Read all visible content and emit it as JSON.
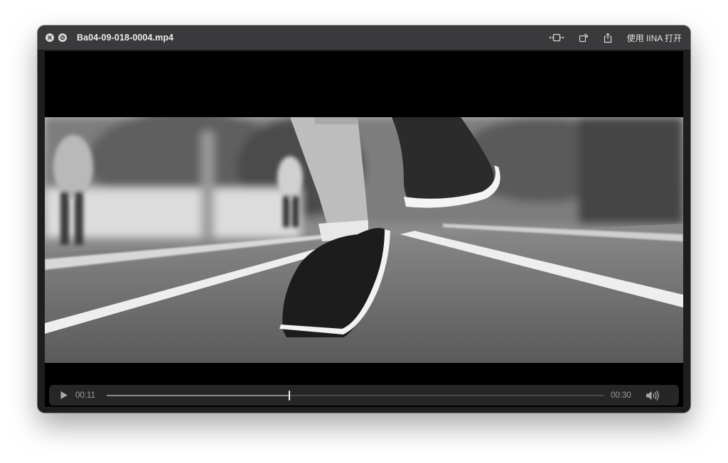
{
  "window": {
    "title": "Ba04-09-018-0004.mp4",
    "open_with_label": "使用 IINA 打开"
  },
  "toolbar": {
    "icons": [
      "close-icon",
      "fullscreen-disabled-icon",
      "trim-icon",
      "rotate-icon",
      "share-icon"
    ]
  },
  "player": {
    "current_time": "00:11",
    "duration": "00:30",
    "progress": 0.3667,
    "state": "paused",
    "video_description_hidden": true
  },
  "colors": {
    "titlebar": "#3a3a3c",
    "controls_bg": "#262626",
    "letterbox": "#000000"
  }
}
